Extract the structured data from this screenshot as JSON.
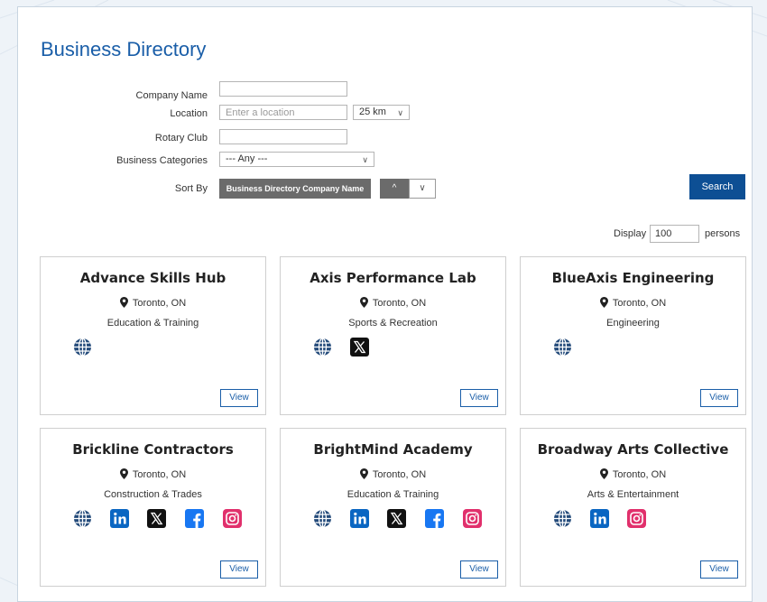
{
  "title": "Business Directory",
  "form": {
    "company_name_label": "Company Name",
    "location_label": "Location",
    "location_placeholder": "Enter a location",
    "radius": "25 km",
    "rotary_club_label": "Rotary Club",
    "categories_label": "Business Categories",
    "categories_value": "--- Any ---",
    "sort_label": "Sort By",
    "sort_value": "Business Directory Company Name",
    "search_label": "Search",
    "display_label": "Display",
    "display_value": "100",
    "persons_label": "persons"
  },
  "glyphs": {
    "up": "^",
    "down": "∨"
  },
  "view_label": "View",
  "colors": {
    "brand": "#1a5ea8",
    "button": "#0d4f94",
    "linkedin": "#0a66c2",
    "facebook": "#1877f2",
    "instagram": "#e1306c"
  },
  "cards": [
    {
      "name": "Advance Skills Hub",
      "location": "Toronto, ON",
      "category": "Education & Training",
      "icons": [
        "globe-icon"
      ]
    },
    {
      "name": "Axis Performance Lab",
      "location": "Toronto, ON",
      "category": "Sports & Recreation",
      "icons": [
        "globe-icon",
        "x-icon"
      ]
    },
    {
      "name": "BlueAxis Engineering",
      "location": "Toronto, ON",
      "category": "Engineering",
      "icons": [
        "globe-icon"
      ]
    },
    {
      "name": "Brickline Contractors",
      "location": "Toronto, ON",
      "category": "Construction & Trades",
      "icons": [
        "globe-icon",
        "linkedin-icon",
        "x-icon",
        "facebook-icon",
        "instagram-icon"
      ]
    },
    {
      "name": "BrightMind Academy",
      "location": "Toronto, ON",
      "category": "Education & Training",
      "icons": [
        "globe-icon",
        "linkedin-icon",
        "x-icon",
        "facebook-icon",
        "instagram-icon"
      ]
    },
    {
      "name": "Broadway Arts Collective",
      "location": "Toronto, ON",
      "category": "Arts & Entertainment",
      "icons": [
        "globe-icon",
        "linkedin-icon",
        "instagram-icon"
      ]
    }
  ]
}
